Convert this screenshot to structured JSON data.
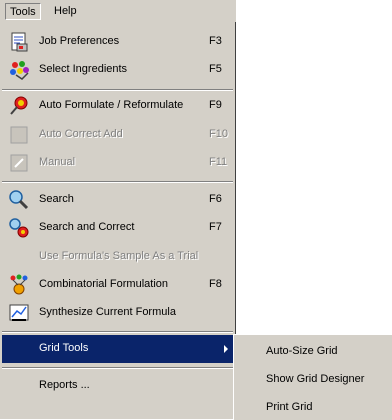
{
  "menubar": {
    "tools_label": "Tools",
    "help_label": "Help"
  },
  "tools_menu": {
    "job_preferences": {
      "label": "Job Preferences",
      "shortcut": "F3",
      "icon": "job-preferences-icon"
    },
    "select_ingredients": {
      "label": "Select Ingredients",
      "shortcut": "F5",
      "icon": "select-ingredients-icon"
    },
    "auto_formulate": {
      "label": "Auto Formulate / Reformulate",
      "shortcut": "F9",
      "icon": "auto-formulate-icon"
    },
    "auto_correct_add": {
      "label": "Auto Correct Add",
      "shortcut": "F10",
      "icon": "auto-correct-add-icon",
      "enabled": false
    },
    "manual": {
      "label": "Manual",
      "shortcut": "F11",
      "icon": "manual-icon",
      "enabled": false
    },
    "search": {
      "label": "Search",
      "shortcut": "F6",
      "icon": "search-icon"
    },
    "search_and_correct": {
      "label": "Search and Correct",
      "shortcut": "F7",
      "icon": "search-and-correct-icon"
    },
    "use_formula_sample": {
      "label": "Use Formula's Sample As a Trial",
      "enabled": false
    },
    "combinatorial_formulation": {
      "label": "Combinatorial Formulation",
      "shortcut": "F8",
      "icon": "combinatorial-formulation-icon"
    },
    "synthesize_current_formula": {
      "label": "Synthesize Current Formula",
      "icon": "synthesize-formula-icon"
    },
    "grid_tools": {
      "label": "Grid Tools",
      "has_submenu": true
    },
    "reports": {
      "label": "Reports ..."
    }
  },
  "grid_tools_submenu": {
    "items": [
      "Auto-Size Grid",
      "Show Grid Designer",
      "Print Grid"
    ]
  },
  "colors": {
    "menu_bg": "#d4d0c8",
    "highlight_bg": "#0a246a",
    "disabled_text": "#808080"
  }
}
